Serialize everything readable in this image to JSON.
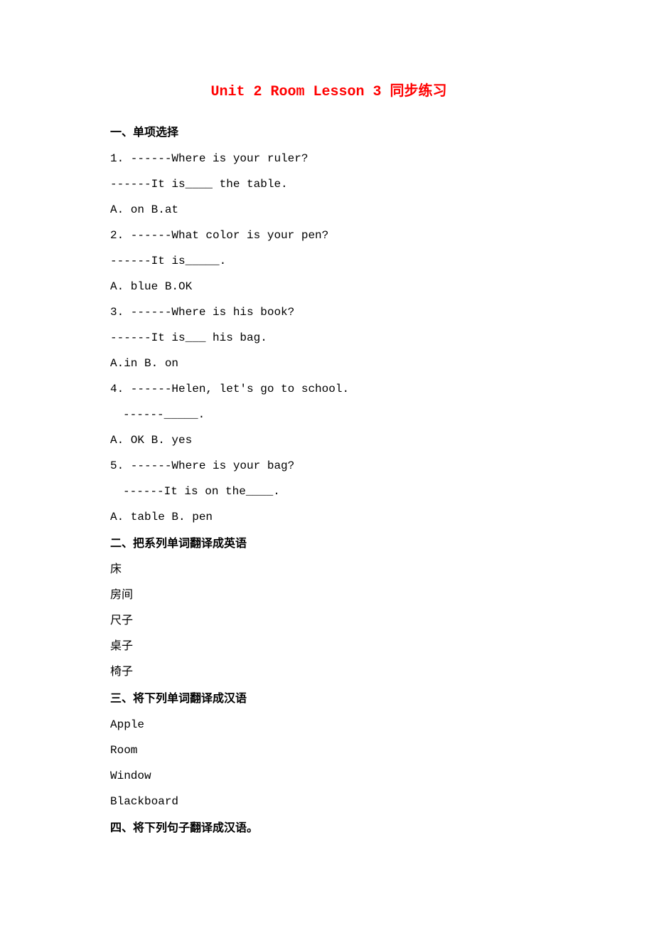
{
  "title": "Unit 2 Room Lesson 3 同步练习",
  "sections": {
    "s1": {
      "heading": "一、单项选择",
      "items": {
        "q1": {
          "prompt": "1. ------Where is your ruler?",
          "follow": "------It is____ the table.",
          "opts": "A. on  B.at"
        },
        "q2": {
          "prompt": "2. ------What color is your pen?",
          "follow": "------It is_____.",
          "opts": "A. blue  B.OK"
        },
        "q3": {
          "prompt": "3. ------Where is his book?",
          "follow": "------It is___ his bag.",
          "opts": "A.in   B. on"
        },
        "q4": {
          "prompt": "4. ------Helen, let's go to school.",
          "follow": "------_____.",
          "opts": "A. OK  B. yes"
        },
        "q5": {
          "prompt": "5. ------Where is your bag?",
          "follow": "------It is on the____.",
          "opts": "A. table  B. pen"
        }
      }
    },
    "s2": {
      "heading": "二、把系列单词翻译成英语",
      "items": {
        "w1": "床",
        "w2": "房间",
        "w3": "尺子",
        "w4": "桌子",
        "w5": "椅子"
      }
    },
    "s3": {
      "heading": "三、将下列单词翻译成汉语",
      "items": {
        "w1": "Apple",
        "w2": "Room",
        "w3": "Window",
        "w4": "Blackboard"
      }
    },
    "s4": {
      "heading": "四、将下列句子翻译成汉语。"
    }
  }
}
